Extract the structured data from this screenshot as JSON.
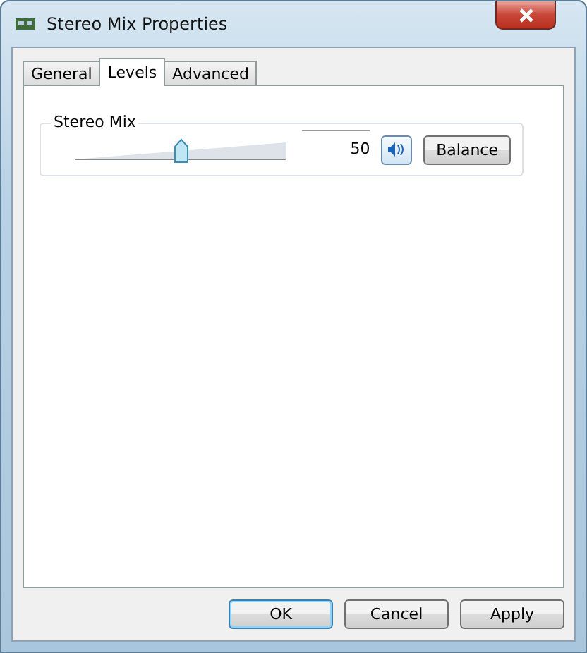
{
  "window": {
    "title": "Stereo Mix Properties"
  },
  "tabs": [
    {
      "label": "General",
      "selected": false
    },
    {
      "label": "Levels",
      "selected": true
    },
    {
      "label": "Advanced",
      "selected": false
    }
  ],
  "channels": [
    {
      "name": "Stereo Mix",
      "level": 0.5,
      "reading": "50",
      "muted": false,
      "balance": "Balance"
    }
  ],
  "buttons": [
    {
      "label": "OK",
      "default": true
    },
    {
      "label": "Cancel",
      "default": false
    },
    {
      "label": "Apply",
      "default": false
    }
  ]
}
